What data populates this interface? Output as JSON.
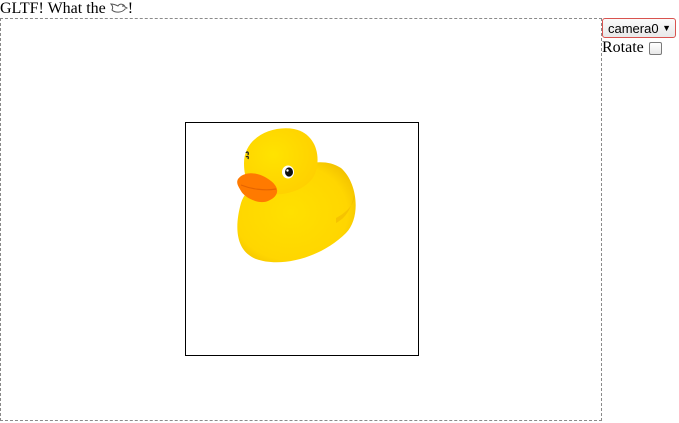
{
  "header": {
    "title_prefix": "GLTF! What the ",
    "title_suffix": "!",
    "title_icon": "bird-icon"
  },
  "viewer": {
    "model_icon": "rubber-duck",
    "duck_body_color": "#FFD400",
    "duck_beak_color": "#FF7A00"
  },
  "controls": {
    "camera_selected": "camera0",
    "rotate_label": "Rotate",
    "rotate_checked": false
  }
}
